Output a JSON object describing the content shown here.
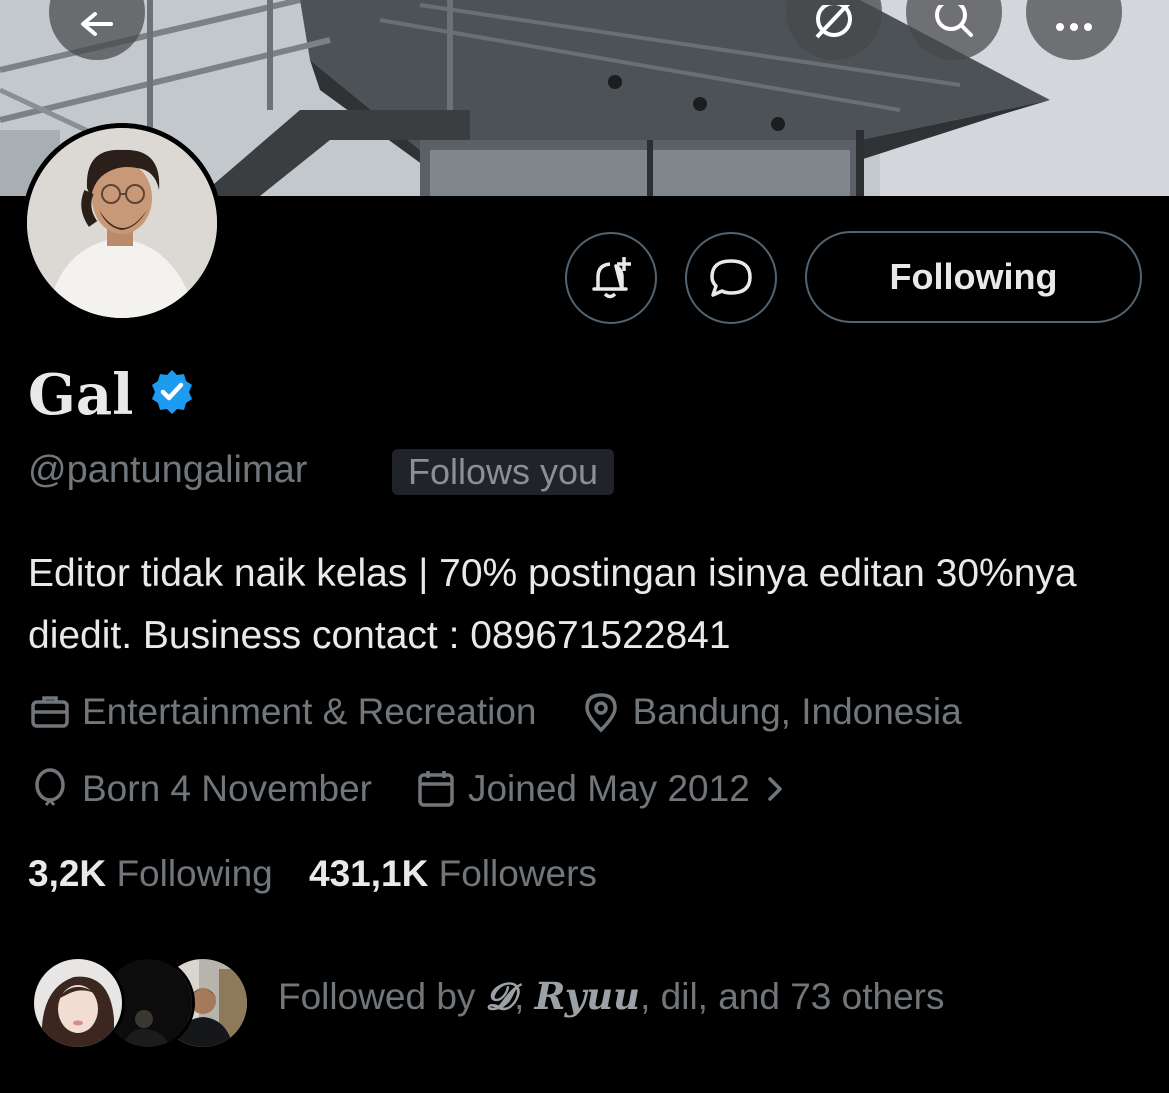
{
  "profile": {
    "name": "Gal",
    "handle": "@pantungalimar",
    "follows_you": "Follows you",
    "bio": "Editor tidak naik kelas | 70% postingan isinya editan 30%nya diedit. Business contact : 089671522841",
    "category": "Entertainment & Recreation",
    "location": "Bandung, Indonesia",
    "born": "Born 4 November",
    "joined": "Joined May 2012"
  },
  "actions": {
    "following_label": "Following"
  },
  "stats": {
    "following_count": "3,2K",
    "following_label": "Following",
    "followers_count": "431,1K",
    "followers_label": "Followers"
  },
  "followed_by": {
    "prefix": "Followed by",
    "name1": "𝓓",
    "name2": "Ryuu",
    "rest": "dil, and 73 others"
  },
  "colors": {
    "background": "#000000",
    "text_primary": "#e7e9ea",
    "text_secondary": "#71767b",
    "verified_blue": "#1d9bf0",
    "border": "#536471"
  },
  "icons": [
    "back-arrow-icon",
    "grok-icon",
    "search-icon",
    "more-icon",
    "bell-plus-icon",
    "message-icon",
    "verified-badge-icon",
    "briefcase-icon",
    "location-pin-icon",
    "balloon-icon",
    "calendar-icon",
    "chevron-right-icon"
  ]
}
